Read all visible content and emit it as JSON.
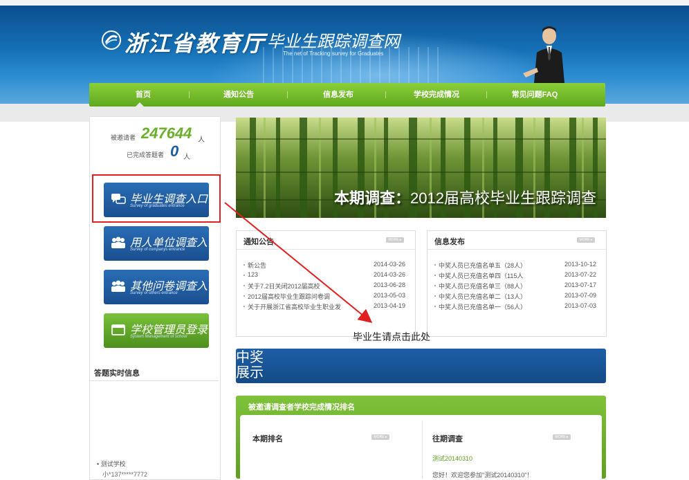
{
  "header": {
    "logo_main": "浙江省教育厅",
    "logo_sub": "毕业生跟踪调查网",
    "logo_en": "The net of Tracking survey for Graduates"
  },
  "nav": {
    "items": [
      "首页",
      "通知公告",
      "信息发布",
      "学校完成情况",
      "常见问题FAQ"
    ]
  },
  "stats": {
    "invited_label": "被邀请者",
    "invited_count": "247644",
    "invited_unit": "人",
    "done_label": "已完成答题者",
    "done_count": "0",
    "done_unit": "人"
  },
  "entries": [
    {
      "title": "毕业生调查入口",
      "subtitle": "Survey of graduates entrance",
      "icon": "chat-bubbles-icon"
    },
    {
      "title": "用人单位调查入口",
      "subtitle": "Survey of companys entrance",
      "icon": "group-icon"
    },
    {
      "title": "其他问卷调查入口",
      "subtitle": "Survey of others entrance",
      "icon": "group-icon"
    },
    {
      "title": "学校管理员登录",
      "subtitle": "System Management of school",
      "icon": "window-icon"
    }
  ],
  "live": {
    "title": "答题实时信息",
    "school": "• 测试学校",
    "user": "小*137*****7772"
  },
  "banner": {
    "label": "本期调查",
    "colon": "：",
    "text": "2012届高校毕业生跟踪调查"
  },
  "notices": {
    "title": "通知公告",
    "more": "MORE ▸",
    "items": [
      {
        "title": "新公告",
        "date": "2014-03-26"
      },
      {
        "title": "123",
        "date": "2014-03-26"
      },
      {
        "title": "关于7.2日关闭2012届高校",
        "date": "2013-06-28"
      },
      {
        "title": "2012届高校毕业生跟踪问卷调",
        "date": "2013-05-03"
      },
      {
        "title": "关于开展浙江省高校毕业生职业发",
        "date": "2013-04-19"
      }
    ]
  },
  "info": {
    "title": "信息发布",
    "more": "MORE ▸",
    "items": [
      {
        "title": "中奖人员已充值名单五（28人）",
        "date": "2013-10-12"
      },
      {
        "title": "中奖人员已充值名单四（115人",
        "date": "2013-07-22"
      },
      {
        "title": "中奖人员已充值名单三（88人）",
        "date": "2013-07-17"
      },
      {
        "title": "中奖人员已充值名单二（13人）",
        "date": "2013-07-09"
      },
      {
        "title": "中奖人员已充值名单一（56人）",
        "date": "2013-07-03"
      }
    ]
  },
  "annotation": "毕业生请点击此处",
  "award": {
    "line1": "中奖",
    "line2": "展示"
  },
  "ranking": {
    "title": "被邀请调查者学校完成情况排名",
    "current": "本期排名",
    "past": "往期调查",
    "more": "MORE ▸",
    "past_link": "测试20140310",
    "past_text": "您好！欢迎您参加\"测试20140310\"！"
  },
  "colors": {
    "brand_blue": "#1a5ca8",
    "brand_green": "#6ab02a",
    "highlight_red": "#e02020"
  }
}
